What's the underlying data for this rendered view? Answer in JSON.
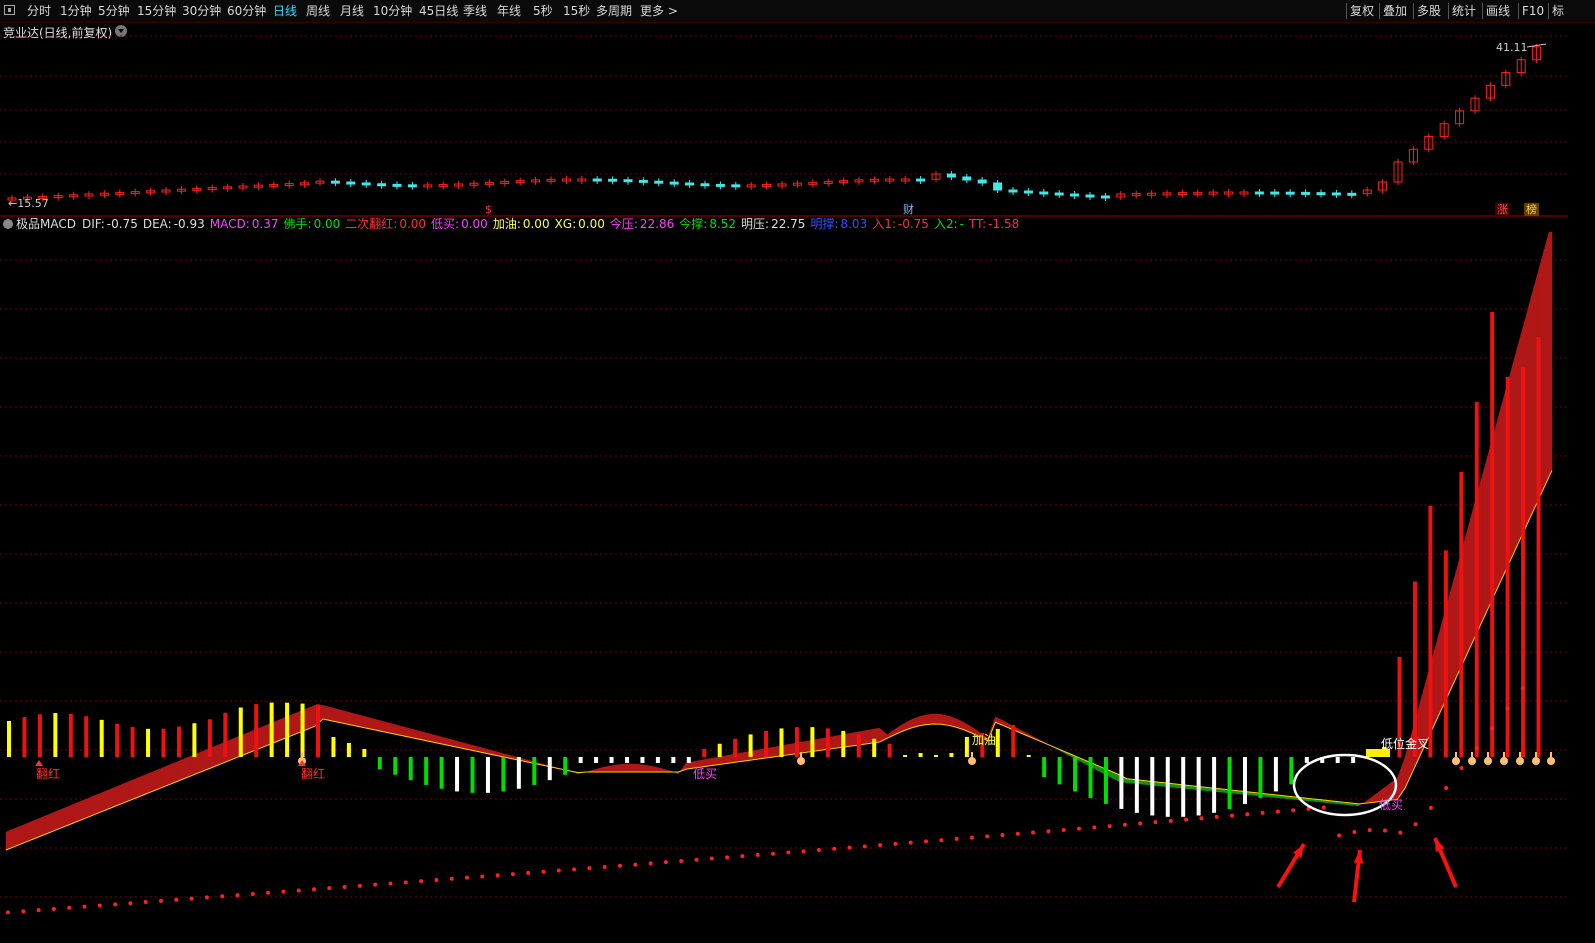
{
  "toolbar": {
    "periods": [
      "分时",
      "1分钟",
      "5分钟",
      "15分钟",
      "30分钟",
      "60分钟",
      "日线",
      "周线",
      "月线",
      "10分钟",
      "45日线",
      "季线",
      "年线",
      "5秒",
      "15秒",
      "多周期",
      "更多 >"
    ],
    "active_period": "日线",
    "right_tools": [
      "复权",
      "叠加",
      "多股",
      "统计",
      "画线",
      "F10",
      "标"
    ]
  },
  "stock": {
    "title": "竞业达(日线,前复权)",
    "high_label": "41.11",
    "low_label": "←15.57",
    "event_marks": [
      "$",
      "财",
      "涨",
      "榜"
    ]
  },
  "indicator": {
    "name": "极品MACD",
    "fields": [
      {
        "label": "DIF:",
        "value": "-0.75",
        "color": "#dddddd"
      },
      {
        "label": "DEA:",
        "value": "-0.93",
        "color": "#dddddd"
      },
      {
        "label": "MACD:",
        "value": "0.37",
        "color": "#ff40ff"
      },
      {
        "label": "佛手:",
        "value": "0.00",
        "color": "#00e000"
      },
      {
        "label": "二次翻红:",
        "value": "0.00",
        "color": "#ff3030"
      },
      {
        "label": "低买:",
        "value": "0.00",
        "color": "#ff40ff"
      },
      {
        "label": "加油:",
        "value": "0.00",
        "color": "#ffff40"
      },
      {
        "label": "XG:",
        "value": "0.00",
        "color": "#ffff40"
      },
      {
        "label": "今压:",
        "value": "22.86",
        "color": "#ff40ff"
      },
      {
        "label": "今撑:",
        "value": "8.52",
        "color": "#00e000"
      },
      {
        "label": "明压:",
        "value": "22.75",
        "color": "#dddddd"
      },
      {
        "label": "明撑:",
        "value": "8.03",
        "color": "#3050ff"
      },
      {
        "label": "入1:",
        "value": "-0.75",
        "color": "#ff3030"
      },
      {
        "label": "入2:",
        "value": "-",
        "color": "#00e000"
      },
      {
        "label": "TT:",
        "value": "-1.58",
        "color": "#ff3030"
      }
    ],
    "signals": {
      "fanhong": "翻红",
      "dimai": "低买",
      "jiayou": "加油",
      "diwei_jincha": "低位金叉"
    }
  },
  "colors": {
    "up": "#ff2020",
    "down": "#40e8e8",
    "macd_red": "#ee1111",
    "macd_yellow": "#ffff00",
    "macd_green": "#00dd00",
    "macd_white": "#ffffff",
    "ribbon_red": "#b01818",
    "ribbon_green": "#109010",
    "grid": "#7a0000"
  }
}
